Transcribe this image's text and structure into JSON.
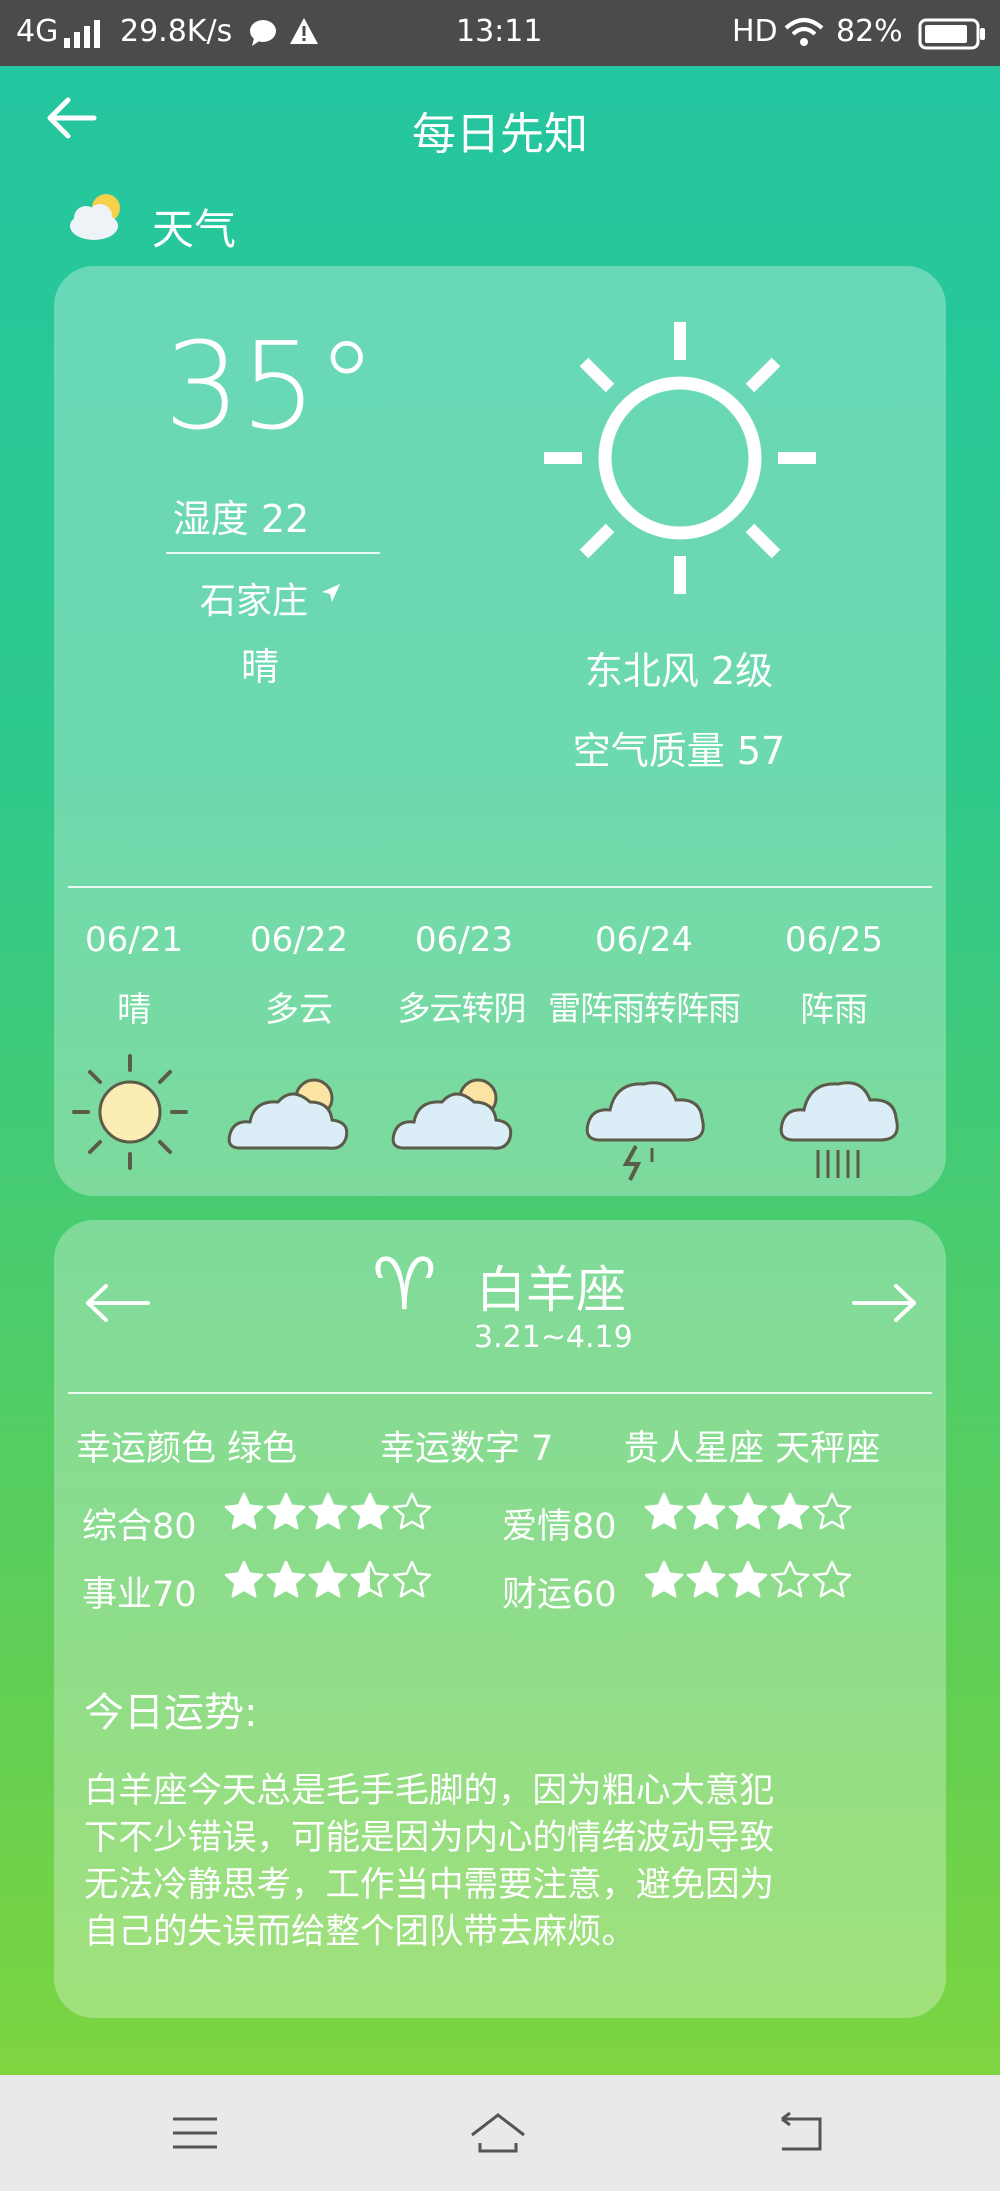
{
  "status_bar": {
    "network": "4G",
    "speed": "29.8K/s",
    "time": "13:11",
    "hd": "HD",
    "battery": "82%"
  },
  "header": {
    "title": "每日先知",
    "back_icon": "arrow-left-icon"
  },
  "section": {
    "title": "天气",
    "icon": "partly-cloudy-icon"
  },
  "weather": {
    "temperature": "35°",
    "humidity_label": "湿度 22",
    "city": "石家庄",
    "condition": "晴",
    "wind": "东北风 2级",
    "air_quality": "空气质量 57",
    "icon": "sun-icon",
    "forecast": [
      {
        "date": "06/21",
        "desc": "晴",
        "icon": "sunny-icon"
      },
      {
        "date": "06/22",
        "desc": "多云",
        "icon": "partly-cloudy-icon"
      },
      {
        "date": "06/23",
        "desc": "多云转阴",
        "icon": "partly-cloudy-icon"
      },
      {
        "date": "06/24",
        "desc": "雷阵雨转阵雨",
        "icon": "thunderstorm-icon"
      },
      {
        "date": "06/25",
        "desc": "阵雨",
        "icon": "shower-icon"
      }
    ]
  },
  "horoscope": {
    "symbol": "♈",
    "name": "白羊座",
    "dates": "3.21~4.19",
    "lucky_color": "幸运颜色 绿色",
    "lucky_number": "幸运数字 7",
    "noble_sign": "贵人星座 天秤座",
    "ratings": [
      {
        "label": "综合80",
        "stars": 4
      },
      {
        "label": "爱情80",
        "stars": 4
      },
      {
        "label": "事业70",
        "stars": 3.5
      },
      {
        "label": "财运60",
        "stars": 3
      }
    ],
    "fortune_title": "今日运势:",
    "fortune_text": [
      "白羊座今天总是毛手毛脚的，因为粗心大意犯",
      "下不少错误，可能是因为内心的情绪波动导致",
      "无法冷静思考，工作当中需要注意，避免因为",
      "自己的失误而给整个团队带去麻烦。"
    ]
  },
  "colors": {
    "status_bar": "#4b4b4b",
    "bg_top": "#23c6a2",
    "bg_bottom": "#86d73a",
    "nav_bar": "#e9e9ea"
  }
}
